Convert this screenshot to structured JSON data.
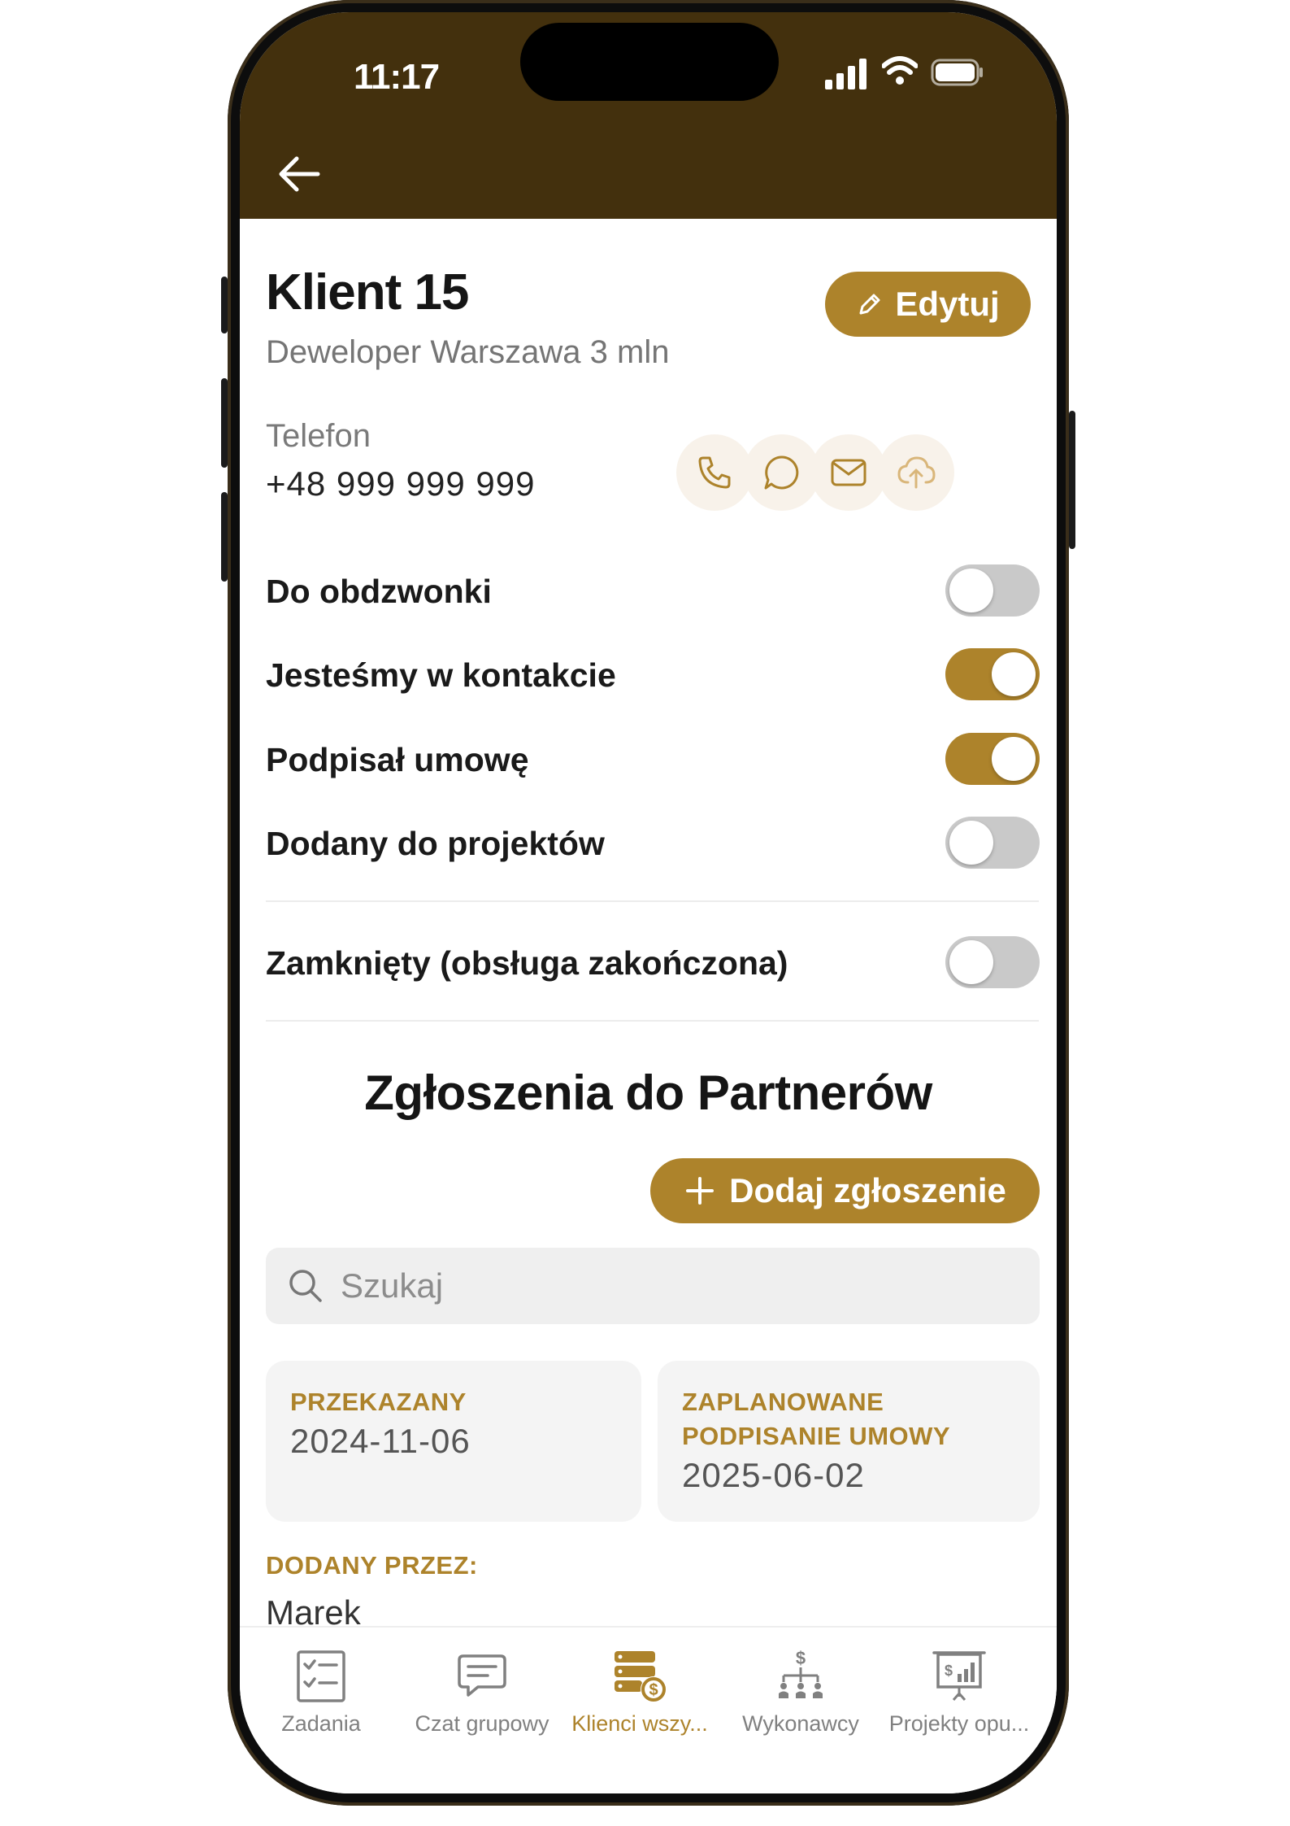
{
  "status_bar": {
    "time": "11:17"
  },
  "client": {
    "name": "Klient 15",
    "description": "Deweloper Warszawa 3 mln",
    "edit_label": "Edytuj",
    "phone_label": "Telefon",
    "phone_number": "+48 999 999 999"
  },
  "actions": [
    "phone-icon",
    "chat-icon",
    "mail-icon",
    "cloud-upload-icon"
  ],
  "toggles": [
    {
      "label": "Do obdzwonki",
      "on": false
    },
    {
      "label": "Jesteśmy w kontakcie",
      "on": true
    },
    {
      "label": "Podpisał umowę",
      "on": true
    },
    {
      "label": "Dodany do projektów",
      "on": false
    },
    {
      "label": "Zamknięty (obsługa zakończona)",
      "on": false
    }
  ],
  "partners": {
    "section_title": "Zgłoszenia do Partnerów",
    "add_label": "Dodaj zgłoszenie",
    "search_placeholder": "Szukaj",
    "cards": [
      {
        "label": "PRZEKAZANY",
        "value": "2024-11-06"
      },
      {
        "label_line1": "ZAPLANOWANE",
        "label_line2": "PODPISANIE UMOWY",
        "value": "2025-06-02"
      }
    ],
    "added_by_label": "DODANY PRZEZ:",
    "added_by_value": "Marek"
  },
  "tabbar": {
    "active": "Klienci wszy...",
    "items": [
      {
        "label": "Zadania",
        "icon": "tasks-icon"
      },
      {
        "label": "Czat grupowy",
        "icon": "chat-bubble-icon"
      },
      {
        "label": "Klienci wszy...",
        "icon": "clients-money-icon"
      },
      {
        "label": "Wykonawcy",
        "icon": "org-chart-dollar-icon"
      },
      {
        "label": "Projekty opu...",
        "icon": "presentation-chart-icon"
      }
    ]
  },
  "colors": {
    "brand": "#ad832b",
    "header": "#43300d",
    "toggle_off": "#c9c9c9",
    "card_bg": "#f4f4f4"
  }
}
